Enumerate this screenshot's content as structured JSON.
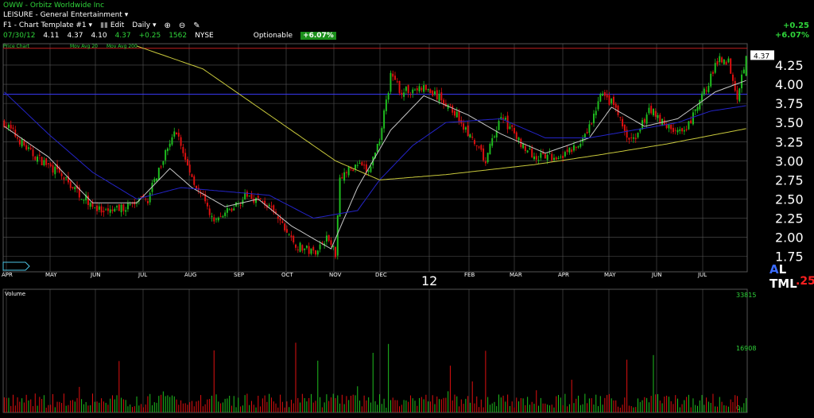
{
  "header": {
    "symbol_title": "OWW - Orbitz Worldwide Inc",
    "sector": "LEISURE - General Entertainment",
    "template": "F1 - Chart Template #1",
    "edit_label": "Edit",
    "period": "Daily",
    "date": "07/30/12",
    "open": "4.11",
    "high": "4.37",
    "low": "4.10",
    "close": "4.37",
    "change": "+0.25",
    "volume": "1562",
    "exchange": "NYSE",
    "optionable": "Optionable",
    "pct_badge": "+6.07%",
    "right_change": "+0.25",
    "right_pct": "+6.07%"
  },
  "legend": {
    "price_chart": "Price Chart",
    "ma20": "Mov Avg 20",
    "ma200": "Mov Avg 200"
  },
  "timeframe": {
    "a": "A",
    "rest": "L TML",
    "sub": ".25"
  },
  "colors": {
    "up": "#1fbf1f",
    "down": "#e01010",
    "ma20": "#c8c8c8",
    "ma50": "#2424c8",
    "ma200": "#c8c83c",
    "grid": "#555555",
    "hline_blue": "#3b3bff",
    "hline_red": "#c02020"
  },
  "chart_data": {
    "type": "candlestick",
    "months": [
      "APR",
      "MAY",
      "JUN",
      "JUL",
      "AUG",
      "SEP",
      "OCT",
      "NOV",
      "DEC",
      "12",
      "FEB",
      "MAR",
      "APR",
      "MAY",
      "JUN",
      "JUL"
    ],
    "y_ticks": [
      1.75,
      2.0,
      2.25,
      2.5,
      2.75,
      3.0,
      3.25,
      3.5,
      3.75,
      4.0,
      4.25
    ],
    "y_labels": [
      "1.75",
      "2.00",
      "2.25",
      "2.50",
      "2.75",
      "3.00",
      "3.25",
      "3.50",
      "3.75",
      "4.00",
      "4.25"
    ],
    "ylim": [
      1.55,
      4.53
    ],
    "last_price_label": "4.37",
    "horizontal_lines": [
      {
        "value": 4.47,
        "color": "red"
      },
      {
        "value": 3.87,
        "color": "blue"
      }
    ],
    "volume_ticks": [
      "33815",
      "16908",
      "0"
    ],
    "volume_max": 33815,
    "volume_label": "Volume",
    "keypoints": [
      [
        0,
        3.5
      ],
      [
        12,
        3.1
      ],
      [
        22,
        2.9
      ],
      [
        35,
        2.55
      ],
      [
        45,
        2.3
      ],
      [
        55,
        2.4
      ],
      [
        65,
        2.5
      ],
      [
        72,
        3.05
      ],
      [
        78,
        3.4
      ],
      [
        82,
        3.0
      ],
      [
        88,
        2.6
      ],
      [
        95,
        2.2
      ],
      [
        102,
        2.35
      ],
      [
        110,
        2.55
      ],
      [
        118,
        2.45
      ],
      [
        125,
        2.2
      ],
      [
        132,
        1.9
      ],
      [
        140,
        1.8
      ],
      [
        146,
        2.0
      ],
      [
        150,
        1.8
      ],
      [
        152,
        2.8
      ],
      [
        160,
        2.95
      ],
      [
        165,
        2.85
      ],
      [
        170,
        3.3
      ],
      [
        175,
        4.1
      ],
      [
        180,
        3.9
      ],
      [
        190,
        3.95
      ],
      [
        198,
        3.8
      ],
      [
        205,
        3.6
      ],
      [
        212,
        3.25
      ],
      [
        218,
        3.0
      ],
      [
        225,
        3.6
      ],
      [
        232,
        3.3
      ],
      [
        240,
        3.05
      ],
      [
        248,
        3.05
      ],
      [
        255,
        3.1
      ],
      [
        262,
        3.25
      ],
      [
        266,
        3.5
      ],
      [
        270,
        3.85
      ],
      [
        276,
        3.75
      ],
      [
        282,
        3.3
      ],
      [
        286,
        3.25
      ],
      [
        292,
        3.7
      ],
      [
        300,
        3.45
      ],
      [
        308,
        3.35
      ],
      [
        314,
        3.7
      ],
      [
        320,
        4.1
      ],
      [
        324,
        4.35
      ],
      [
        328,
        4.3
      ],
      [
        332,
        3.85
      ],
      [
        336,
        4.37
      ]
    ],
    "ma20_keypoints": [
      [
        0,
        3.45
      ],
      [
        20,
        3.05
      ],
      [
        40,
        2.45
      ],
      [
        60,
        2.45
      ],
      [
        75,
        2.9
      ],
      [
        85,
        2.65
      ],
      [
        100,
        2.4
      ],
      [
        115,
        2.5
      ],
      [
        130,
        2.15
      ],
      [
        148,
        1.85
      ],
      [
        160,
        2.65
      ],
      [
        175,
        3.4
      ],
      [
        190,
        3.85
      ],
      [
        210,
        3.6
      ],
      [
        225,
        3.35
      ],
      [
        245,
        3.1
      ],
      [
        265,
        3.3
      ],
      [
        275,
        3.7
      ],
      [
        290,
        3.45
      ],
      [
        305,
        3.55
      ],
      [
        322,
        3.9
      ],
      [
        336,
        4.05
      ]
    ],
    "ma50_keypoints": [
      [
        0,
        3.9
      ],
      [
        20,
        3.35
      ],
      [
        40,
        2.85
      ],
      [
        60,
        2.5
      ],
      [
        80,
        2.65
      ],
      [
        100,
        2.6
      ],
      [
        120,
        2.55
      ],
      [
        140,
        2.25
      ],
      [
        160,
        2.35
      ],
      [
        170,
        2.75
      ],
      [
        185,
        3.2
      ],
      [
        200,
        3.5
      ],
      [
        225,
        3.55
      ],
      [
        245,
        3.3
      ],
      [
        265,
        3.3
      ],
      [
        285,
        3.4
      ],
      [
        305,
        3.5
      ],
      [
        320,
        3.65
      ],
      [
        336,
        3.72
      ]
    ],
    "ma200_keypoints": [
      [
        60,
        4.5
      ],
      [
        90,
        4.2
      ],
      [
        120,
        3.6
      ],
      [
        150,
        3.0
      ],
      [
        170,
        2.75
      ],
      [
        200,
        2.82
      ],
      [
        240,
        2.95
      ],
      [
        270,
        3.08
      ],
      [
        300,
        3.22
      ],
      [
        336,
        3.42
      ]
    ]
  }
}
